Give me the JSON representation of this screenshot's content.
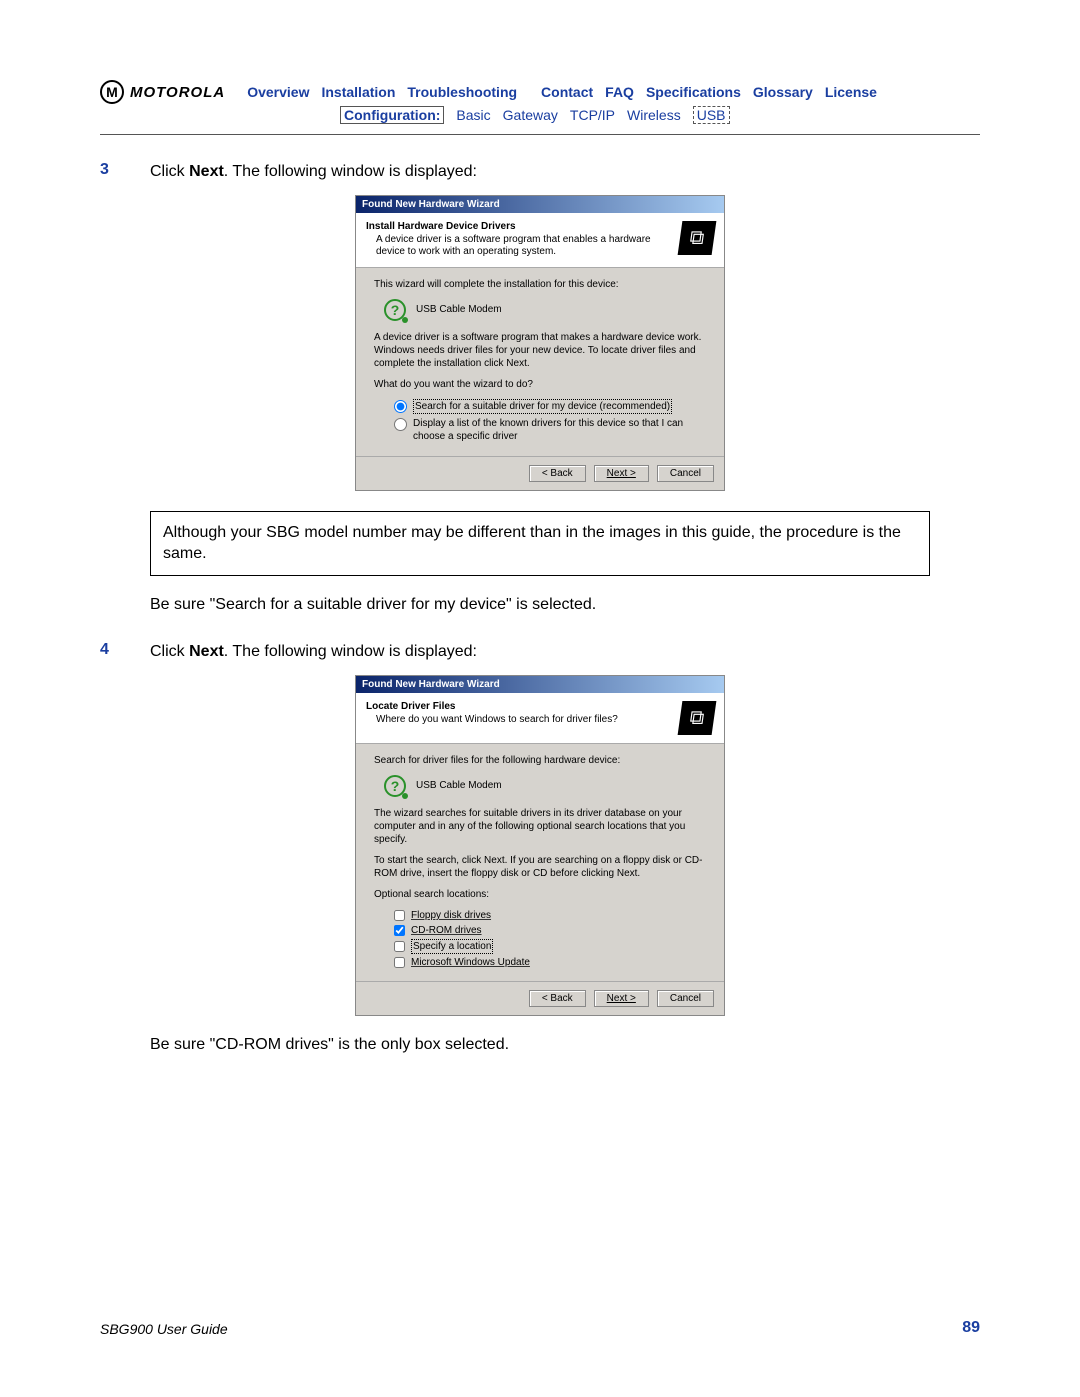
{
  "logo": {
    "brand": "MOTOROLA",
    "glyph": "M"
  },
  "nav": {
    "items": [
      "Overview",
      "Installation",
      "Troubleshooting",
      "Contact",
      "FAQ",
      "Specifications",
      "Glossary",
      "License"
    ],
    "sub_label": "Configuration:",
    "sub_items": [
      "Basic",
      "Gateway",
      "TCP/IP",
      "Wireless",
      "USB"
    ]
  },
  "step3": {
    "num": "3",
    "pre": "Click ",
    "bold": "Next",
    "post": ". The following window is displayed:"
  },
  "wizard1": {
    "title": "Found New Hardware Wizard",
    "head_title": "Install Hardware Device Drivers",
    "head_sub": "A device driver is a software program that enables a hardware device to work with an operating system.",
    "p1": "This wizard will complete the installation for this device:",
    "device": "USB Cable Modem",
    "p2": "A device driver is a software program that makes a hardware device work. Windows needs driver files for your new device. To locate driver files and complete the installation click Next.",
    "p3": "What do you want the wizard to do?",
    "opt1": "Search for a suitable driver for my device (recommended)",
    "opt2": "Display a list of the known drivers for this device so that I can choose a specific driver",
    "btn_back": "< Back",
    "btn_next": "Next >",
    "btn_cancel": "Cancel"
  },
  "note": "Although your SBG model number may be different than in the images in this guide, the procedure is the same.",
  "assert1": "Be sure \"Search for a suitable driver for my device\" is selected.",
  "step4": {
    "num": "4",
    "pre": "Click ",
    "bold": "Next",
    "post": ". The following window is displayed:"
  },
  "wizard2": {
    "title": "Found New Hardware Wizard",
    "head_title": "Locate Driver Files",
    "head_sub": "Where do you want Windows to search for driver files?",
    "p1": "Search for driver files for the following hardware device:",
    "device": "USB Cable Modem",
    "p2": "The wizard searches for suitable drivers in its driver database on your computer and in any of the following optional search locations that you specify.",
    "p3": "To start the search, click Next. If you are searching on a floppy disk or CD-ROM drive, insert the floppy disk or CD before clicking Next.",
    "p4": "Optional search locations:",
    "c1": "Floppy disk drives",
    "c2": "CD-ROM drives",
    "c3": "Specify a location",
    "c4": "Microsoft Windows Update",
    "btn_back": "< Back",
    "btn_next": "Next >",
    "btn_cancel": "Cancel"
  },
  "assert2": "Be sure \"CD-ROM drives\" is the only box selected.",
  "footer": {
    "left": "SBG900 User Guide",
    "right": "89"
  }
}
